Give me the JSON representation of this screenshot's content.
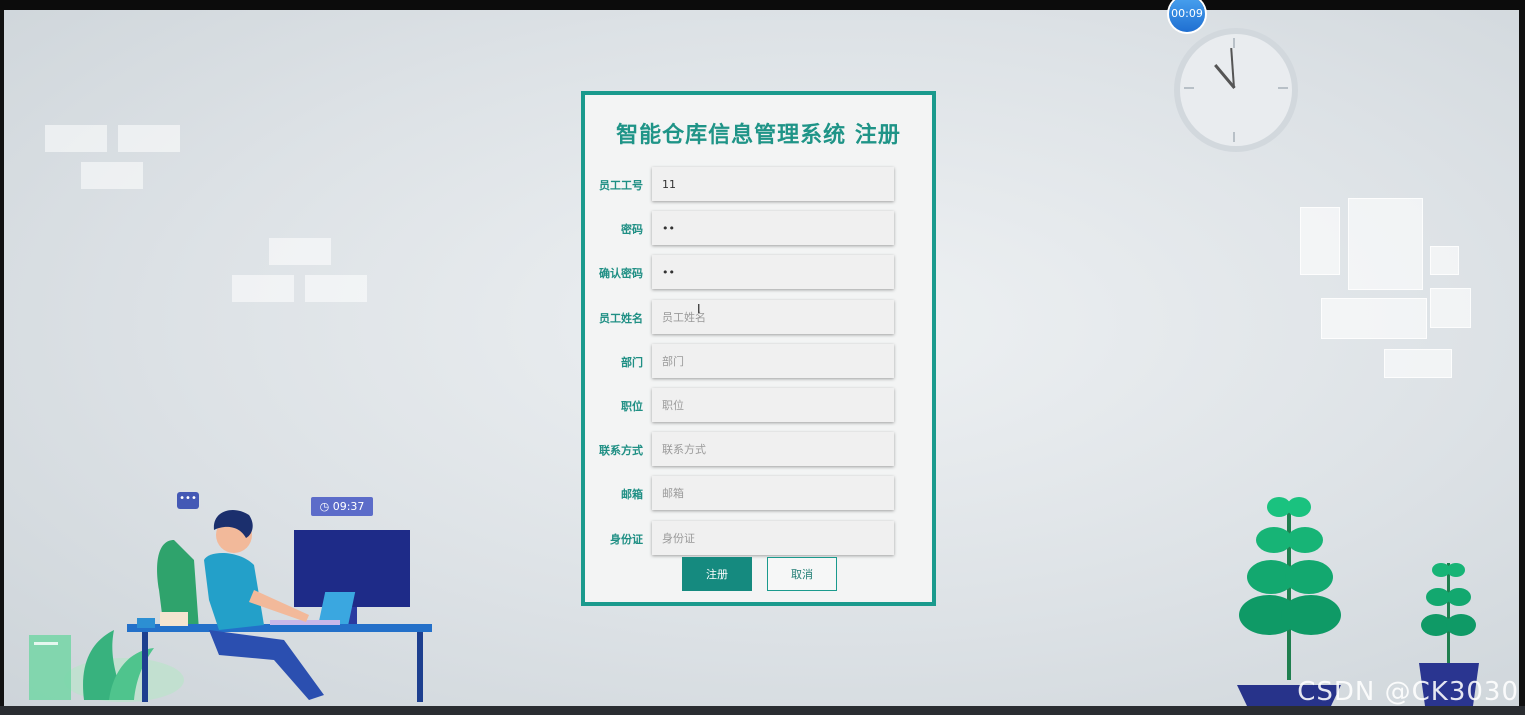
{
  "timer": {
    "label": "00:09"
  },
  "illustration": {
    "time_badge": "09:37",
    "chat_badge": "•••"
  },
  "form": {
    "title": "智能仓库信息管理系统 注册",
    "fields": [
      {
        "label": "员工工号",
        "value": "11",
        "placeholder": ""
      },
      {
        "label": "密码",
        "value": "••",
        "placeholder": ""
      },
      {
        "label": "确认密码",
        "value": "••",
        "placeholder": ""
      },
      {
        "label": "员工姓名",
        "value": "",
        "placeholder": "员工姓名"
      },
      {
        "label": "部门",
        "value": "",
        "placeholder": "部门"
      },
      {
        "label": "职位",
        "value": "",
        "placeholder": "职位"
      },
      {
        "label": "联系方式",
        "value": "",
        "placeholder": "联系方式"
      },
      {
        "label": "邮箱",
        "value": "",
        "placeholder": "邮箱"
      },
      {
        "label": "身份证",
        "value": "",
        "placeholder": "身份证"
      }
    ],
    "buttons": {
      "submit": "注册",
      "cancel": "取消"
    }
  },
  "watermark": "CSDN @CK3030",
  "colors": {
    "accent": "#1a9a8d",
    "primary_button": "#158a7f"
  }
}
